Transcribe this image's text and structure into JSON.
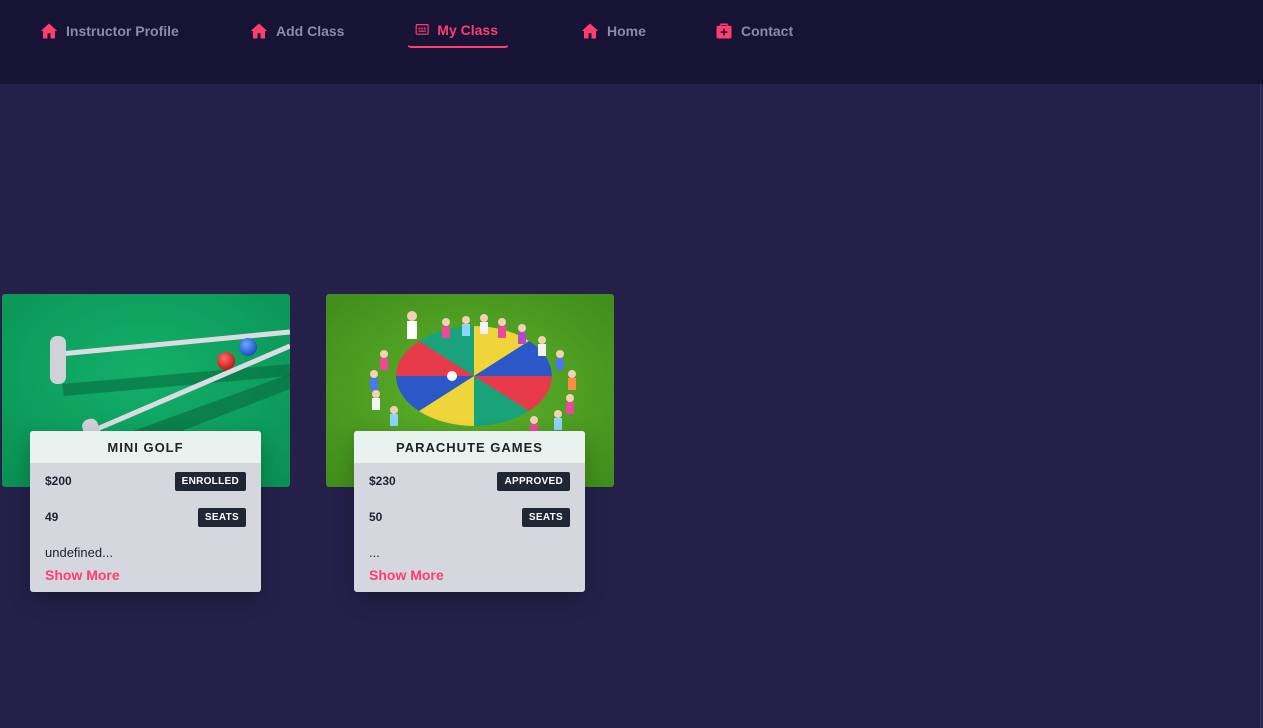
{
  "nav": {
    "items": [
      {
        "label": "Instructor Profile",
        "icon": "home-icon"
      },
      {
        "label": "Add Class",
        "icon": "home-icon"
      },
      {
        "label": "My Class",
        "icon": "classroom-icon",
        "active": true
      },
      {
        "label": "Home",
        "icon": "home-icon"
      },
      {
        "label": "Contact",
        "icon": "briefcase-medical-icon"
      }
    ]
  },
  "colors": {
    "background": "#24204a",
    "navbar": "#161335",
    "accent": "#ff3d6e",
    "nav_text": "#8d8aa7",
    "card_panel": "#d5d7df",
    "badge": "#1f2735"
  },
  "classes": [
    {
      "title": "MINI GOLF",
      "price": "$200",
      "status": "ENROLLED",
      "seats_value": "49",
      "seats_label": "SEATS",
      "description": "undefined...",
      "show_more": "Show More",
      "image": "mini-golf-photo"
    },
    {
      "title": "PARACHUTE GAMES",
      "price": "$230",
      "status": "APPROVED",
      "seats_value": "50",
      "seats_label": "SEATS",
      "description": "...",
      "show_more": "Show More",
      "image": "parachute-games-photo"
    }
  ]
}
